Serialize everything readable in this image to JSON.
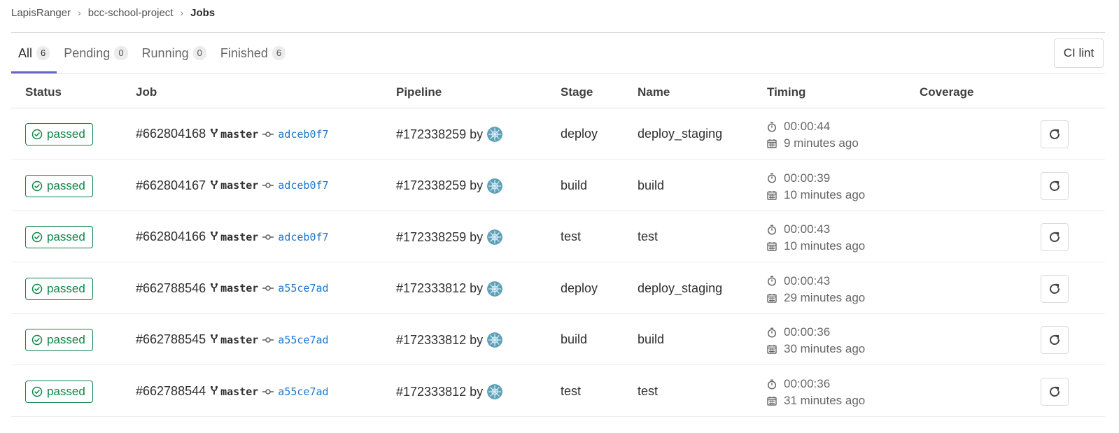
{
  "breadcrumb": {
    "items": [
      "LapisRanger",
      "bcc-school-project"
    ],
    "current": "Jobs"
  },
  "tabs": [
    {
      "label": "All",
      "count": "6"
    },
    {
      "label": "Pending",
      "count": "0"
    },
    {
      "label": "Running",
      "count": "0"
    },
    {
      "label": "Finished",
      "count": "6"
    }
  ],
  "ci_lint_label": "CI lint",
  "table": {
    "headers": [
      "Status",
      "Job",
      "Pipeline",
      "Stage",
      "Name",
      "Timing",
      "Coverage"
    ],
    "rows": [
      {
        "status": "passed",
        "job_id": "#662804168",
        "branch": "master",
        "sha": "adceb0f7",
        "pipeline": "#172338259",
        "by": "by",
        "stage": "deploy",
        "name": "deploy_staging",
        "duration": "00:00:44",
        "ago": "9 minutes ago"
      },
      {
        "status": "passed",
        "job_id": "#662804167",
        "branch": "master",
        "sha": "adceb0f7",
        "pipeline": "#172338259",
        "by": "by",
        "stage": "build",
        "name": "build",
        "duration": "00:00:39",
        "ago": "10 minutes ago"
      },
      {
        "status": "passed",
        "job_id": "#662804166",
        "branch": "master",
        "sha": "adceb0f7",
        "pipeline": "#172338259",
        "by": "by",
        "stage": "test",
        "name": "test",
        "duration": "00:00:43",
        "ago": "10 minutes ago"
      },
      {
        "status": "passed",
        "job_id": "#662788546",
        "branch": "master",
        "sha": "a55ce7ad",
        "pipeline": "#172333812",
        "by": "by",
        "stage": "deploy",
        "name": "deploy_staging",
        "duration": "00:00:43",
        "ago": "29 minutes ago"
      },
      {
        "status": "passed",
        "job_id": "#662788545",
        "branch": "master",
        "sha": "a55ce7ad",
        "pipeline": "#172333812",
        "by": "by",
        "stage": "build",
        "name": "build",
        "duration": "00:00:36",
        "ago": "30 minutes ago"
      },
      {
        "status": "passed",
        "job_id": "#662788544",
        "branch": "master",
        "sha": "a55ce7ad",
        "pipeline": "#172333812",
        "by": "by",
        "stage": "test",
        "name": "test",
        "duration": "00:00:36",
        "ago": "31 minutes ago"
      }
    ]
  },
  "colors": {
    "success": "#108548",
    "link": "#1f75cb",
    "active_tab": "#6666c4"
  }
}
